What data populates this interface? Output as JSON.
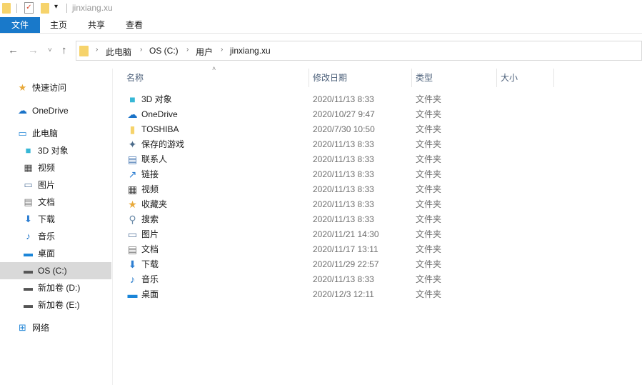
{
  "window": {
    "title": "jinxiang.xu"
  },
  "ribbon": {
    "tabs": [
      "文件",
      "主页",
      "共享",
      "查看"
    ]
  },
  "address": {
    "crumbs": [
      "此电脑",
      "OS (C:)",
      "用户",
      "jinxiang.xu"
    ]
  },
  "sidebar": {
    "items": [
      {
        "label": "快速访问",
        "icon": "star-icon"
      },
      {
        "label": "OneDrive",
        "icon": "cloud-icon"
      },
      {
        "label": "此电脑",
        "icon": "computer-icon"
      },
      {
        "label": "3D 对象",
        "icon": "cube-icon"
      },
      {
        "label": "视频",
        "icon": "film-icon"
      },
      {
        "label": "图片",
        "icon": "picture-icon"
      },
      {
        "label": "文档",
        "icon": "document-icon"
      },
      {
        "label": "下载",
        "icon": "download-icon"
      },
      {
        "label": "音乐",
        "icon": "music-icon"
      },
      {
        "label": "桌面",
        "icon": "desktop-icon"
      },
      {
        "label": "OS (C:)",
        "icon": "drive-icon"
      },
      {
        "label": "新加卷 (D:)",
        "icon": "drive-icon"
      },
      {
        "label": "新加卷 (E:)",
        "icon": "drive-icon"
      },
      {
        "label": "网络",
        "icon": "network-icon"
      }
    ]
  },
  "columns": [
    "名称",
    "修改日期",
    "类型",
    "大小"
  ],
  "files": [
    {
      "name": "3D 对象",
      "date": "2020/11/13 8:33",
      "type": "文件夹",
      "icon": "cube-icon"
    },
    {
      "name": "OneDrive",
      "date": "2020/10/27 9:47",
      "type": "文件夹",
      "icon": "cloud-icon"
    },
    {
      "name": "TOSHIBA",
      "date": "2020/7/30 10:50",
      "type": "文件夹",
      "icon": "folder-icon"
    },
    {
      "name": "保存的游戏",
      "date": "2020/11/13 8:33",
      "type": "文件夹",
      "icon": "game-icon"
    },
    {
      "name": "联系人",
      "date": "2020/11/13 8:33",
      "type": "文件夹",
      "icon": "contacts-icon"
    },
    {
      "name": "链接",
      "date": "2020/11/13 8:33",
      "type": "文件夹",
      "icon": "link-icon"
    },
    {
      "name": "视频",
      "date": "2020/11/13 8:33",
      "type": "文件夹",
      "icon": "film-icon"
    },
    {
      "name": "收藏夹",
      "date": "2020/11/13 8:33",
      "type": "文件夹",
      "icon": "star-icon"
    },
    {
      "name": "搜索",
      "date": "2020/11/13 8:33",
      "type": "文件夹",
      "icon": "search-icon"
    },
    {
      "name": "图片",
      "date": "2020/11/21 14:30",
      "type": "文件夹",
      "icon": "picture-icon"
    },
    {
      "name": "文档",
      "date": "2020/11/17 13:11",
      "type": "文件夹",
      "icon": "document-icon"
    },
    {
      "name": "下载",
      "date": "2020/11/29 22:57",
      "type": "文件夹",
      "icon": "download-icon"
    },
    {
      "name": "音乐",
      "date": "2020/11/13 8:33",
      "type": "文件夹",
      "icon": "music-icon"
    },
    {
      "name": "桌面",
      "date": "2020/12/3 12:11",
      "type": "文件夹",
      "icon": "desktop-icon"
    }
  ]
}
